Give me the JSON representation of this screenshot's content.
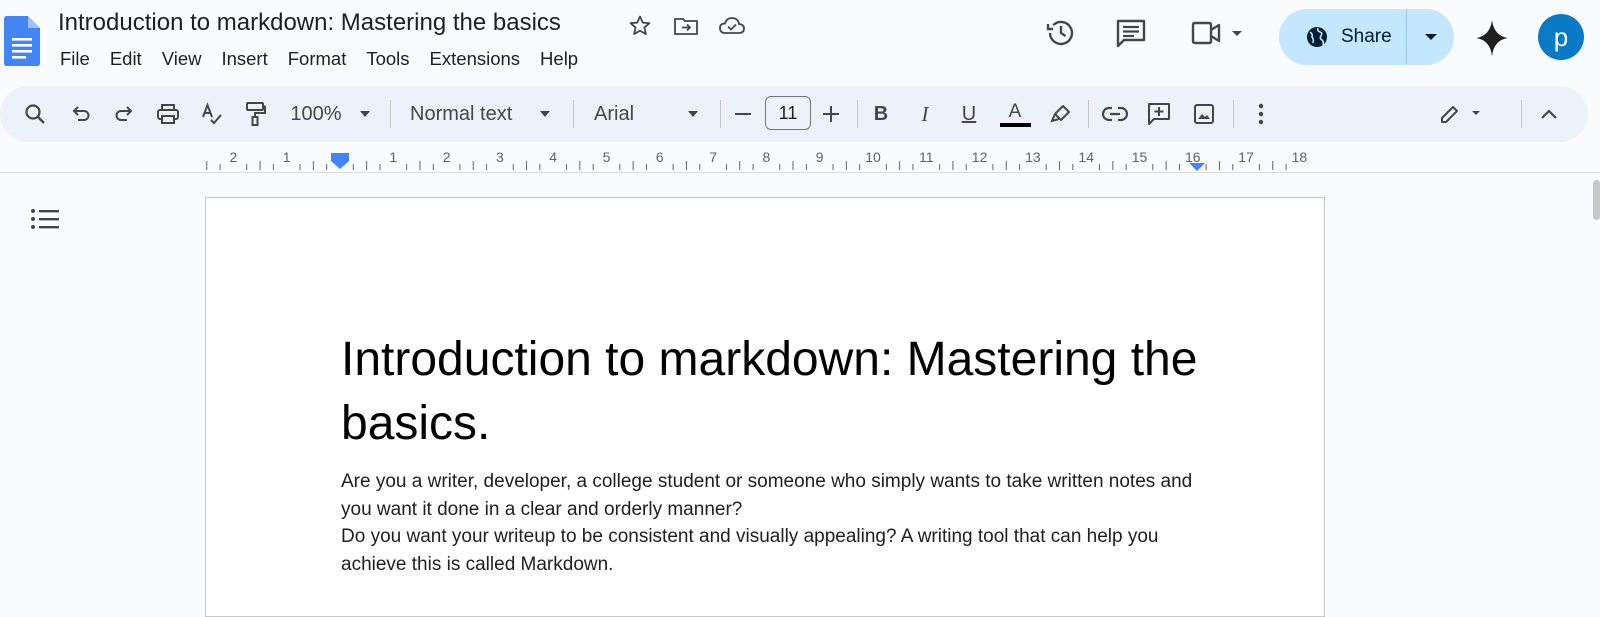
{
  "app": {
    "doc_title": "Introduction to markdown: Mastering the basics",
    "avatar_letter": "p",
    "share_label": "Share",
    "accent": "#0b57d0"
  },
  "menu": [
    "File",
    "Edit",
    "View",
    "Insert",
    "Format",
    "Tools",
    "Extensions",
    "Help"
  ],
  "toolbar": {
    "zoom": "100%",
    "style": "Normal text",
    "font": "Arial",
    "font_size": "11",
    "bold": "B",
    "italic": "I",
    "underline": "U",
    "text_color": "A"
  },
  "ruler": {
    "labels": [
      "2",
      "1",
      "1",
      "2",
      "3",
      "4",
      "5",
      "6",
      "7",
      "8",
      "9",
      "10",
      "11",
      "12",
      "13",
      "14",
      "15",
      "16",
      "17",
      "18"
    ]
  },
  "document": {
    "heading": "Introduction to markdown: Mastering the basics.",
    "paragraph_1": "Are you a writer, developer, a college student or someone who simply wants to take written notes and you want it done in a clear and orderly manner?",
    "paragraph_2": "Do you want your writeup to be consistent and visually appealing? A writing tool that can help you achieve this is called Markdown."
  },
  "icons": [
    "docs-logo-icon",
    "star-icon",
    "move-folder-icon",
    "cloud-saved-icon",
    "history-icon",
    "comment-icon",
    "meet-icon",
    "globe-icon",
    "gemini-icon",
    "search-icon",
    "undo-icon",
    "redo-icon",
    "print-icon",
    "spellcheck-icon",
    "paint-format-icon",
    "link-icon",
    "add-comment-icon",
    "image-icon",
    "more-icon",
    "pencil-icon",
    "collapse-icon",
    "outline-icon"
  ]
}
